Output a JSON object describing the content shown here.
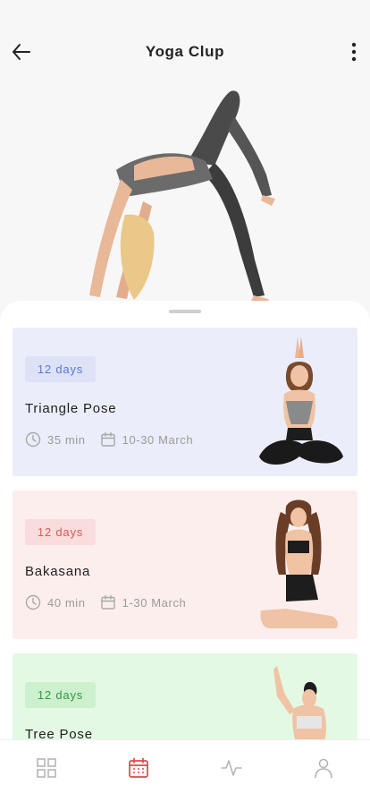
{
  "header": {
    "title": "Yoga Clup"
  },
  "workouts": [
    {
      "badge": "12 days",
      "name": "Triangle Pose",
      "duration": "35 min",
      "dates": "10-30 March",
      "bg": "#ebedfb",
      "badge_bg": "#dde2f6",
      "badge_color": "#5a79d3"
    },
    {
      "badge": "12 days",
      "name": "Bakasana",
      "duration": "40 min",
      "dates": "1-30 March",
      "bg": "#fdeeee",
      "badge_bg": "#f9dcdc",
      "badge_color": "#d9595b"
    },
    {
      "badge": "12 days",
      "name": "Tree Pose",
      "duration": "",
      "dates": "",
      "bg": "#e3f9e3",
      "badge_bg": "#cdf0cf",
      "badge_color": "#2f9a3e"
    }
  ],
  "nav": {
    "items": [
      "dashboard-icon",
      "calendar-icon",
      "activity-icon",
      "profile-icon"
    ],
    "active": "calendar-icon",
    "active_color": "#e0474c",
    "inactive_color": "#b5b5b5"
  }
}
